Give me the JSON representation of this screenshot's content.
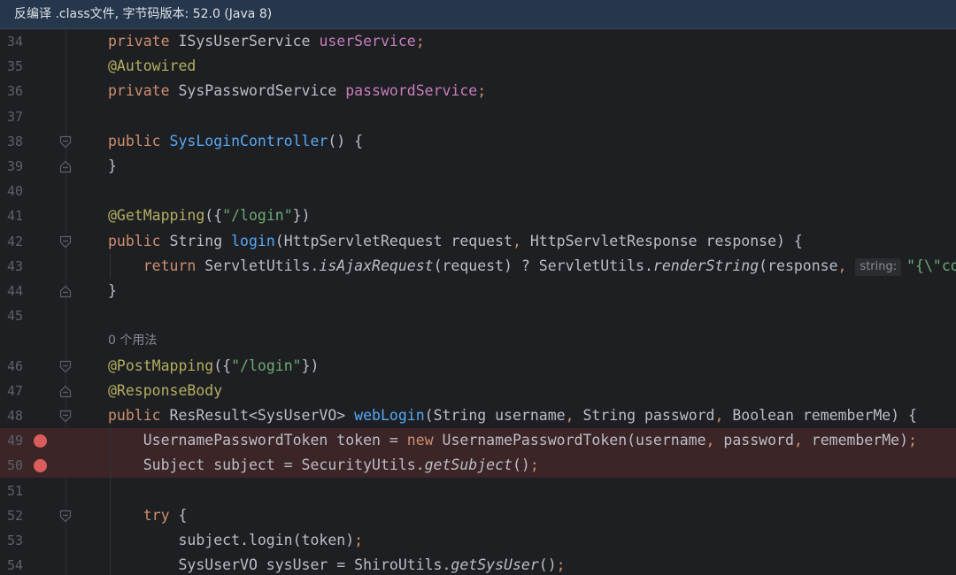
{
  "banner": {
    "text": "反编译 .class文件, 字节码版本: 52.0 (Java 8)"
  },
  "editor": {
    "usage_hint": "0 个用法",
    "param_hint": "string:",
    "lines": [
      {
        "num": "34",
        "tokens": [
          [
            "kw",
            "private "
          ],
          [
            "",
            "ISysUserService "
          ],
          [
            "fld",
            "userService"
          ],
          [
            "kw",
            ";"
          ]
        ]
      },
      {
        "num": "35",
        "tokens": [
          [
            "ann",
            "@Autowired"
          ]
        ]
      },
      {
        "num": "36",
        "tokens": [
          [
            "kw",
            "private "
          ],
          [
            "",
            "SysPasswordService "
          ],
          [
            "fld",
            "passwordService"
          ],
          [
            "kw",
            ";"
          ]
        ]
      },
      {
        "num": "37",
        "tokens": []
      },
      {
        "num": "38",
        "fold": "open",
        "tokens": [
          [
            "kw",
            "public "
          ],
          [
            "fn",
            "SysLoginController"
          ],
          [
            "",
            "() {"
          ]
        ]
      },
      {
        "num": "39",
        "fold": "close",
        "tokens": [
          [
            "",
            "}"
          ]
        ]
      },
      {
        "num": "40",
        "tokens": []
      },
      {
        "num": "41",
        "tokens": [
          [
            "ann",
            "@GetMapping"
          ],
          [
            "",
            "({"
          ],
          [
            "str",
            "\"/login\""
          ],
          [
            "",
            "})"
          ]
        ]
      },
      {
        "num": "42",
        "fold": "open",
        "tokens": [
          [
            "kw",
            "public "
          ],
          [
            "",
            "String "
          ],
          [
            "fn",
            "login"
          ],
          [
            "",
            "(HttpServletRequest request"
          ],
          [
            "kw",
            ", "
          ],
          [
            "",
            "HttpServletResponse response) {"
          ]
        ]
      },
      {
        "num": "43",
        "tokens": [
          [
            "kw",
            "    return "
          ],
          [
            "",
            "ServletUtils."
          ],
          [
            "it",
            "isAjaxRequest"
          ],
          [
            "",
            "(request) ? ServletUtils."
          ],
          [
            "it",
            "renderString"
          ],
          [
            "",
            "(response"
          ],
          [
            "kw",
            ", "
          ],
          [
            "hint",
            ""
          ],
          [
            "str",
            "\"{\\\"code"
          ]
        ]
      },
      {
        "num": "44",
        "fold": "close",
        "tokens": [
          [
            "",
            "}"
          ]
        ]
      },
      {
        "num": "45",
        "tokens": []
      },
      {
        "num": "",
        "usage": true,
        "tokens": []
      },
      {
        "num": "46",
        "fold": "open",
        "tokens": [
          [
            "ann",
            "@PostMapping"
          ],
          [
            "",
            "({"
          ],
          [
            "str",
            "\"/login\""
          ],
          [
            "",
            "})"
          ]
        ]
      },
      {
        "num": "47",
        "fold": "close",
        "tokens": [
          [
            "ann",
            "@ResponseBody"
          ]
        ]
      },
      {
        "num": "48",
        "fold": "open",
        "tokens": [
          [
            "kw",
            "public "
          ],
          [
            "",
            "ResResult<SysUserVO> "
          ],
          [
            "fn",
            "webLogin"
          ],
          [
            "",
            "(String username"
          ],
          [
            "kw",
            ", "
          ],
          [
            "",
            "String password"
          ],
          [
            "kw",
            ", "
          ],
          [
            "",
            "Boolean rememberMe) {"
          ]
        ]
      },
      {
        "num": "49",
        "breakpoint": true,
        "tokens": [
          [
            "",
            "    UsernamePasswordToken token = "
          ],
          [
            "kw",
            "new "
          ],
          [
            "",
            "UsernamePasswordToken(username"
          ],
          [
            "kw",
            ", "
          ],
          [
            "",
            "password"
          ],
          [
            "kw",
            ", "
          ],
          [
            "",
            "rememberMe)"
          ],
          [
            "kw",
            ";"
          ]
        ]
      },
      {
        "num": "50",
        "breakpoint": true,
        "tokens": [
          [
            "",
            "    Subject subject = SecurityUtils."
          ],
          [
            "it",
            "getSubject"
          ],
          [
            "",
            "()"
          ],
          [
            "kw",
            ";"
          ]
        ]
      },
      {
        "num": "51",
        "tokens": []
      },
      {
        "num": "52",
        "fold": "open",
        "tokens": [
          [
            "kw",
            "    try "
          ],
          [
            "",
            "{"
          ]
        ]
      },
      {
        "num": "53",
        "tokens": [
          [
            "",
            "        subject.login(token)"
          ],
          [
            "kw",
            ";"
          ]
        ]
      },
      {
        "num": "54",
        "tokens": [
          [
            "",
            "        SysUserVO sysUser = ShiroUtils."
          ],
          [
            "it",
            "getSysUser"
          ],
          [
            "",
            "()"
          ],
          [
            "kw",
            ";"
          ]
        ]
      }
    ]
  }
}
